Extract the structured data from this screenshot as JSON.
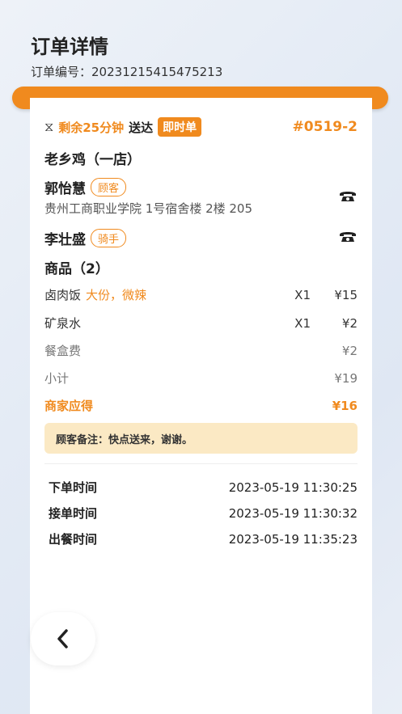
{
  "header": {
    "title": "订单详情",
    "order_no_label": "订单编号：",
    "order_no": "20231215415475213"
  },
  "status": {
    "countdown": "剩余25分钟",
    "deliver_text": "送达",
    "badge": "即时单",
    "serial": "#0519-2"
  },
  "shop": {
    "name": "老乡鸡（一店）"
  },
  "customer": {
    "name": "郭怡慧",
    "role": "顾客",
    "address": "贵州工商职业学院 1号宿舍楼 2楼 205"
  },
  "rider": {
    "name": "李壮盛",
    "role": "骑手"
  },
  "goods": {
    "title": "商品（2）",
    "items": [
      {
        "name": "卤肉饭",
        "spec": "大份，微辣",
        "qty": "X1",
        "price": "¥15"
      },
      {
        "name": "矿泉水",
        "spec": "",
        "qty": "X1",
        "price": "¥2"
      }
    ],
    "box_fee_label": "餐盒费",
    "box_fee": "¥2",
    "subtotal_label": "小计",
    "subtotal": "¥19",
    "merchant_due_label": "商家应得",
    "merchant_due": "¥16"
  },
  "note": "顾客备注：快点送来，谢谢。",
  "times": [
    {
      "label": "下单时间",
      "value": "2023-05-19  11:30:25"
    },
    {
      "label": "接单时间",
      "value": "2023-05-19  11:30:32"
    },
    {
      "label": "出餐时间",
      "value": "2023-05-19  11:35:23"
    }
  ],
  "colors": {
    "accent": "#f08a1e",
    "note_bg": "#fbe9c4"
  },
  "icons": {
    "timer": "hourglass-icon",
    "phone": "phone-icon",
    "back": "chevron-left-icon"
  }
}
